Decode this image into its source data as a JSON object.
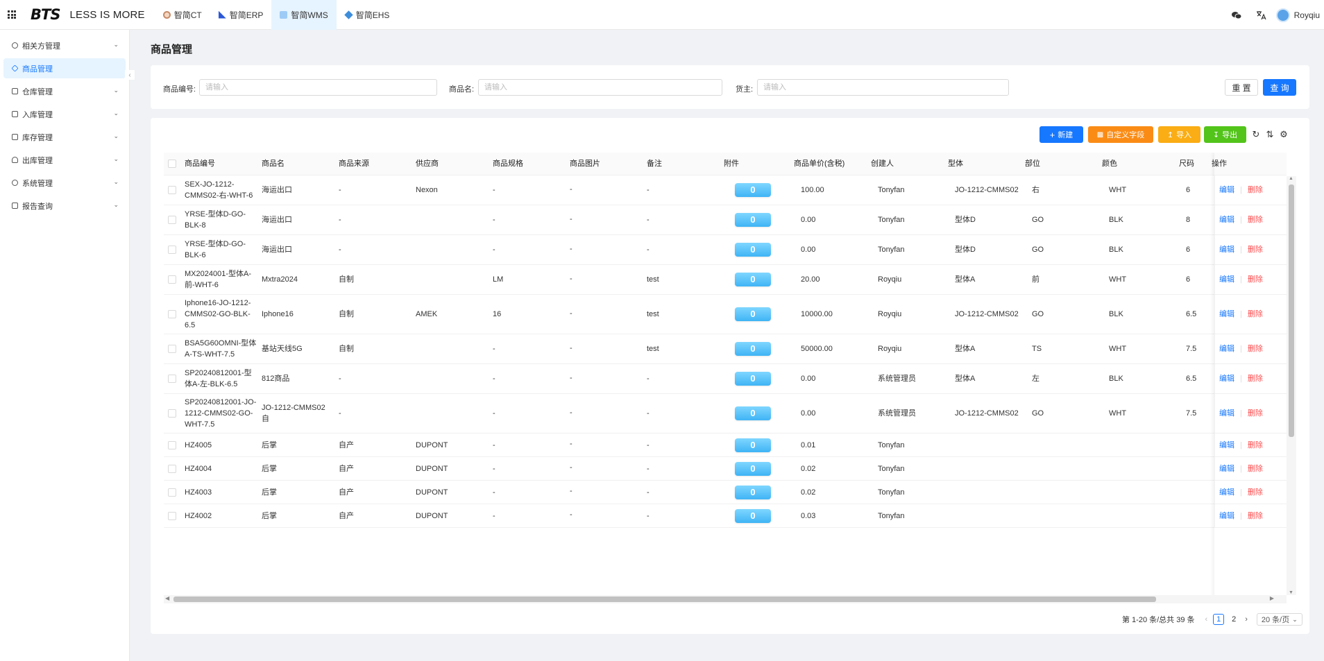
{
  "header": {
    "logo": "BTS",
    "slogan": "LESS IS MORE",
    "systems": [
      {
        "label": "智简CT",
        "active": false
      },
      {
        "label": "智简ERP",
        "active": false
      },
      {
        "label": "智简WMS",
        "active": true
      },
      {
        "label": "智简EHS",
        "active": false
      }
    ],
    "user_name": "Royqiu"
  },
  "sidebar": {
    "items": [
      {
        "label": "相关方管理",
        "active": false,
        "expandable": true
      },
      {
        "label": "商品管理",
        "active": true,
        "expandable": false
      },
      {
        "label": "仓库管理",
        "active": false,
        "expandable": true
      },
      {
        "label": "入库管理",
        "active": false,
        "expandable": true
      },
      {
        "label": "库存管理",
        "active": false,
        "expandable": true
      },
      {
        "label": "出库管理",
        "active": false,
        "expandable": true
      },
      {
        "label": "系统管理",
        "active": false,
        "expandable": true
      },
      {
        "label": "报告查询",
        "active": false,
        "expandable": true
      }
    ]
  },
  "page": {
    "title": "商品管理"
  },
  "search": {
    "code_label": "商品编号:",
    "code_placeholder": "请输入",
    "name_label": "商品名:",
    "name_placeholder": "请输入",
    "owner_label": "货主:",
    "owner_placeholder": "请输入",
    "reset_label": "重 置",
    "query_label": "查 询"
  },
  "toolbar": {
    "new_label": "新建",
    "custom_label": "自定义字段",
    "import_label": "导入",
    "export_label": "导出"
  },
  "table": {
    "columns": [
      "商品编号",
      "商品名",
      "商品来源",
      "供应商",
      "商品规格",
      "商品图片",
      "备注",
      "附件",
      "商品单价(含税)",
      "创建人",
      "型体",
      "部位",
      "颜色",
      "尺码",
      "操作"
    ],
    "edit_label": "编辑",
    "delete_label": "删除",
    "rows": [
      {
        "code": "SEX-JO-1212-CMMS02-右-WHT-6",
        "name": "海运出口",
        "source": "-",
        "supplier": "Nexon",
        "spec": "-",
        "image": "-",
        "remark": "-",
        "attach": "0",
        "price": "100.00",
        "creator": "Tonyfan",
        "model": "JO-1212-CMMS02",
        "part": "右",
        "color": "WHT",
        "size": "6"
      },
      {
        "code": "YRSE-型体D-GO-BLK-8",
        "name": "海运出口",
        "source": "-",
        "supplier": "",
        "spec": "-",
        "image": "-",
        "remark": "-",
        "attach": "0",
        "price": "0.00",
        "creator": "Tonyfan",
        "model": "型体D",
        "part": "GO",
        "color": "BLK",
        "size": "8"
      },
      {
        "code": "YRSE-型体D-GO-BLK-6",
        "name": "海运出口",
        "source": "-",
        "supplier": "",
        "spec": "-",
        "image": "-",
        "remark": "-",
        "attach": "0",
        "price": "0.00",
        "creator": "Tonyfan",
        "model": "型体D",
        "part": "GO",
        "color": "BLK",
        "size": "6"
      },
      {
        "code": "MX2024001-型体A-前-WHT-6",
        "name": "Mxtra2024",
        "source": "自制",
        "supplier": "",
        "spec": "LM",
        "image": "-",
        "remark": "test",
        "attach": "0",
        "price": "20.00",
        "creator": "Royqiu",
        "model": "型体A",
        "part": "前",
        "color": "WHT",
        "size": "6"
      },
      {
        "code": "Iphone16-JO-1212-CMMS02-GO-BLK-6.5",
        "name": "Iphone16",
        "source": "自制",
        "supplier": "AMEK",
        "spec": "16",
        "image": "-",
        "remark": "test",
        "attach": "0",
        "price": "10000.00",
        "creator": "Royqiu",
        "model": "JO-1212-CMMS02",
        "part": "GO",
        "color": "BLK",
        "size": "6.5"
      },
      {
        "code": "BSA5G60OMNI-型体A-TS-WHT-7.5",
        "name": "基站天线5G",
        "source": "自制",
        "supplier": "",
        "spec": "-",
        "image": "-",
        "remark": "test",
        "attach": "0",
        "price": "50000.00",
        "creator": "Royqiu",
        "model": "型体A",
        "part": "TS",
        "color": "WHT",
        "size": "7.5"
      },
      {
        "code": "SP20240812001-型体A-左-BLK-6.5",
        "name": "812商品",
        "source": "-",
        "supplier": "",
        "spec": "-",
        "image": "-",
        "remark": "-",
        "attach": "0",
        "price": "0.00",
        "creator": "系统管理员",
        "model": "型体A",
        "part": "左",
        "color": "BLK",
        "size": "6.5"
      },
      {
        "code": "SP20240812001-JO-1212-CMMS02-GO-WHT-7.5",
        "name": "JO-1212-CMMS02 自",
        "source": "-",
        "supplier": "",
        "spec": "-",
        "image": "-",
        "remark": "-",
        "attach": "0",
        "price": "0.00",
        "creator": "系统管理员",
        "model": "JO-1212-CMMS02",
        "part": "GO",
        "color": "WHT",
        "size": "7.5"
      },
      {
        "code": "HZ4005",
        "name": "后掌",
        "source": "自产",
        "supplier": "DUPONT",
        "spec": "-",
        "image": "-",
        "remark": "-",
        "attach": "0",
        "price": "0.01",
        "creator": "Tonyfan",
        "model": "",
        "part": "",
        "color": "",
        "size": ""
      },
      {
        "code": "HZ4004",
        "name": "后掌",
        "source": "自产",
        "supplier": "DUPONT",
        "spec": "-",
        "image": "-",
        "remark": "-",
        "attach": "0",
        "price": "0.02",
        "creator": "Tonyfan",
        "model": "",
        "part": "",
        "color": "",
        "size": ""
      },
      {
        "code": "HZ4003",
        "name": "后掌",
        "source": "自产",
        "supplier": "DUPONT",
        "spec": "-",
        "image": "-",
        "remark": "-",
        "attach": "0",
        "price": "0.02",
        "creator": "Tonyfan",
        "model": "",
        "part": "",
        "color": "",
        "size": ""
      },
      {
        "code": "HZ4002",
        "name": "后掌",
        "source": "自产",
        "supplier": "DUPONT",
        "spec": "-",
        "image": "-",
        "remark": "-",
        "attach": "0",
        "price": "0.03",
        "creator": "Tonyfan",
        "model": "",
        "part": "",
        "color": "",
        "size": ""
      }
    ]
  },
  "pagination": {
    "total_text": "第 1-20 条/总共 39 条",
    "pages": [
      "1",
      "2"
    ],
    "current": "1",
    "page_size": "20 条/页"
  },
  "colors": {
    "primary": "#1677ff",
    "orange": "#fa8c16",
    "yellow": "#faad14",
    "green": "#52c41a",
    "danger": "#ff4d4f"
  }
}
